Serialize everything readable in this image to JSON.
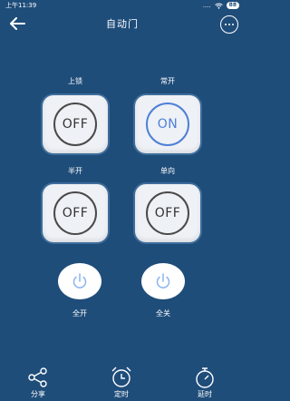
{
  "status": {
    "time": "上午11:39",
    "signal": "....",
    "battery": "88"
  },
  "header": {
    "title": "自动门",
    "back_icon": "arrow-left-icon",
    "more_icon": "more-dots-icon"
  },
  "controls": [
    {
      "label": "上锁",
      "state": "OFF"
    },
    {
      "label": "常开",
      "state": "ON"
    },
    {
      "label": "半开",
      "state": "OFF"
    },
    {
      "label": "单向",
      "state": "OFF"
    }
  ],
  "power": [
    {
      "label": "全开",
      "icon": "power-icon"
    },
    {
      "label": "全关",
      "icon": "power-icon"
    }
  ],
  "bottom_nav": [
    {
      "label": "分享",
      "icon": "share-icon"
    },
    {
      "label": "定时",
      "icon": "alarm-clock-icon"
    },
    {
      "label": "延时",
      "icon": "timer-icon"
    }
  ],
  "colors": {
    "background": "#1f4d7a",
    "on_accent": "#4f7fd8",
    "power_icon": "#8ab4f0"
  }
}
